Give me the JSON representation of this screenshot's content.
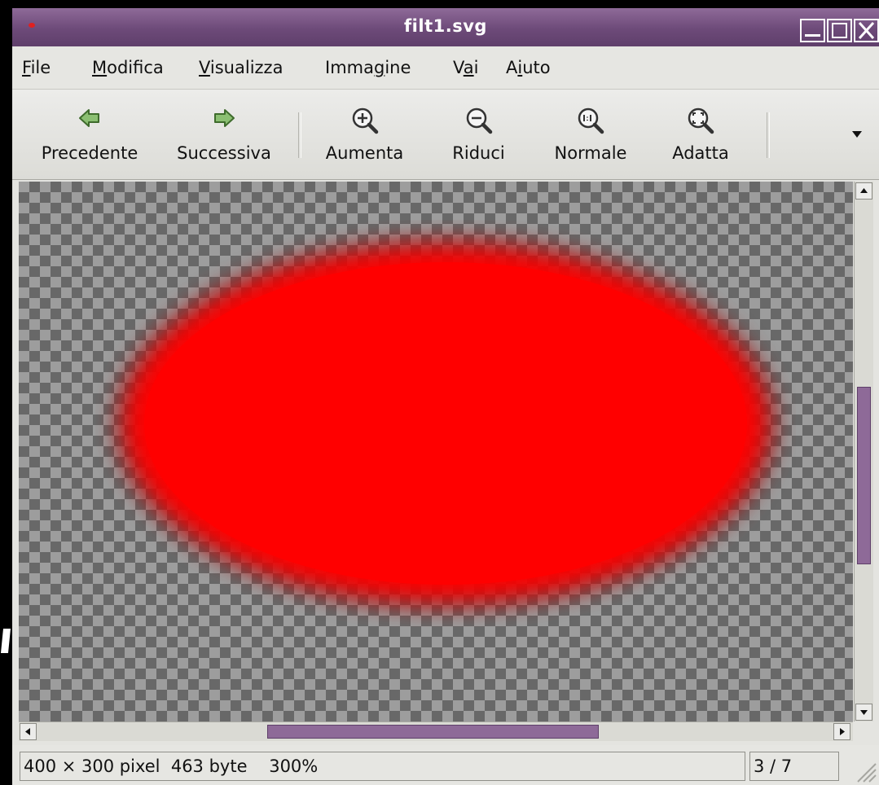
{
  "window": {
    "title": "filt1.svg"
  },
  "menu": [
    {
      "label": "File",
      "mnemonic": "F",
      "rest": "ile"
    },
    {
      "label": "Modifica",
      "mnemonic": "M",
      "rest": "odifica"
    },
    {
      "label": "Visualizza",
      "mnemonic": "V",
      "rest": "isualizza"
    },
    {
      "label": "Immagine",
      "pre": "Imma",
      "mnemonic": "g",
      "rest": "ine"
    },
    {
      "label": "Vai",
      "pre": "V",
      "mnemonic": "a",
      "rest": "i"
    },
    {
      "label": "Aiuto",
      "pre": "A",
      "mnemonic": "i",
      "rest": "uto"
    }
  ],
  "toolbar": {
    "previous": "Precedente",
    "next": "Successiva",
    "zoom_in": "Aumenta",
    "zoom_out": "Riduci",
    "normal": "Normale",
    "fit": "Adatta"
  },
  "status": {
    "info": "400 × 300 pixel  463 byte    300%",
    "position": "3 / 7"
  },
  "colors": {
    "titlebar_accent": "#6d4a79",
    "ellipse_fill": "#ff0000",
    "scroll_thumb": "#8e6a98"
  },
  "icons": [
    "go-previous-icon",
    "go-next-icon",
    "zoom-in-icon",
    "zoom-out-icon",
    "zoom-original-icon",
    "zoom-fit-icon",
    "overflow-arrow-icon"
  ]
}
